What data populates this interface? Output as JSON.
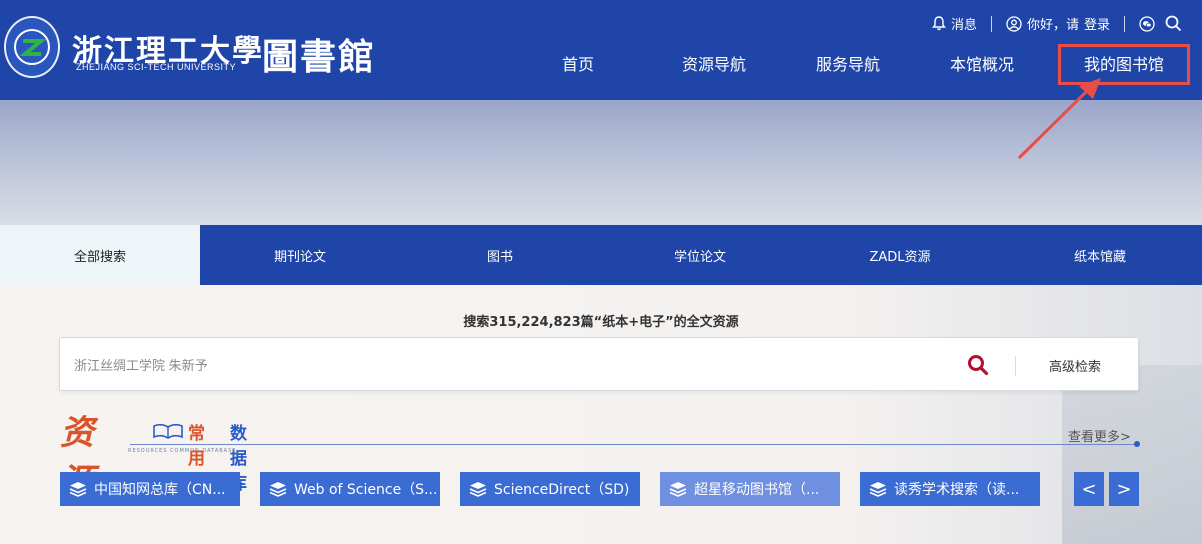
{
  "header": {
    "logo_cn": "浙江理工大學",
    "logo_en": "ZHEJIANG SCI-TECH UNIVERSITY",
    "logo_library": "圖書館",
    "messages_label": "消息",
    "greeting": "你好，请",
    "login_label": "登录",
    "nav": [
      "首页",
      "资源导航",
      "服务导航",
      "本馆概况",
      "我的图书馆"
    ]
  },
  "tabs": [
    "全部搜索",
    "期刊论文",
    "图书",
    "学位论文",
    "ZADL资源",
    "纸本馆藏"
  ],
  "search": {
    "count_text": "搜索315,224,823篇“纸本+电子”的全文资源",
    "placeholder": "浙江丝绸工学院 朱新予",
    "advanced_label": "高级检索"
  },
  "resources": {
    "title_cn": "资源",
    "common": "常用",
    "database": "数据库",
    "en": "RESOURCES   COMMON   DATABASE",
    "more": "查看更多>",
    "items": [
      "中国知网总库（CN...",
      "Web of Science（S...",
      "ScienceDirect（SD)",
      "超星移动图书馆（...",
      "读秀学术搜索（读..."
    ],
    "prev": "<",
    "next": ">"
  },
  "colors": {
    "primary": "#1f45a8",
    "button": "#3b6cd4",
    "accent_red": "#ea4d46",
    "title_orange": "#d9542a"
  }
}
